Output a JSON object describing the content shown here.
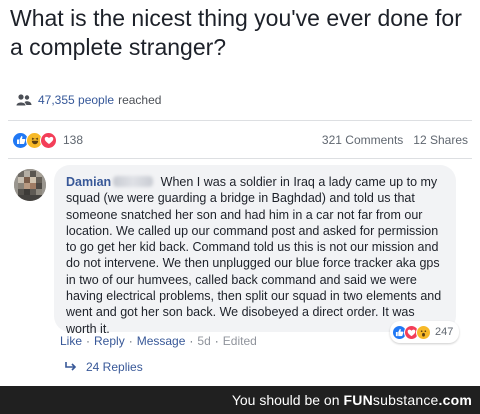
{
  "post": {
    "question": "What is the nicest thing you've ever done for a complete stranger?"
  },
  "reach": {
    "count": "47,355 people",
    "suffix": "reached"
  },
  "reactions": {
    "count": "138",
    "comments": "321 Comments",
    "shares": "12 Shares",
    "emoji_names": [
      "like-icon",
      "haha-icon",
      "love-icon"
    ],
    "colors": {
      "like": "#2078f4",
      "haha": "#f7b928",
      "love": "#f33e58"
    }
  },
  "comment": {
    "author": "Damian",
    "text": "When I was a soldier in Iraq a lady came up to my squad (we were guarding a bridge in Baghdad) and told us that someone snatched her son and had him in a car not far from our location. We called up our command post and asked for permission to go get her kid back. Command told us this is not our mission and do not intervene. We then unplugged our blue force tracker aka gps in two of our humvees, called back command and said we were having electrical problems, then split our squad in two elements and went and got her son back. We disobeyed a direct order. It was worth it.",
    "reaction_count": "247",
    "actions": {
      "like": "Like",
      "reply": "Reply",
      "message": "Message",
      "time": "5d",
      "edited": "Edited",
      "separator": "·"
    },
    "replies": "24 Replies"
  },
  "watermark": {
    "prefix": "You should be on",
    "brand_fun": "FUN",
    "brand_sub": "substance",
    "brand_tld": ".com"
  },
  "colors": {
    "link": "#385898",
    "bubble": "#f2f3f5",
    "watermark_bg": "#202020"
  }
}
